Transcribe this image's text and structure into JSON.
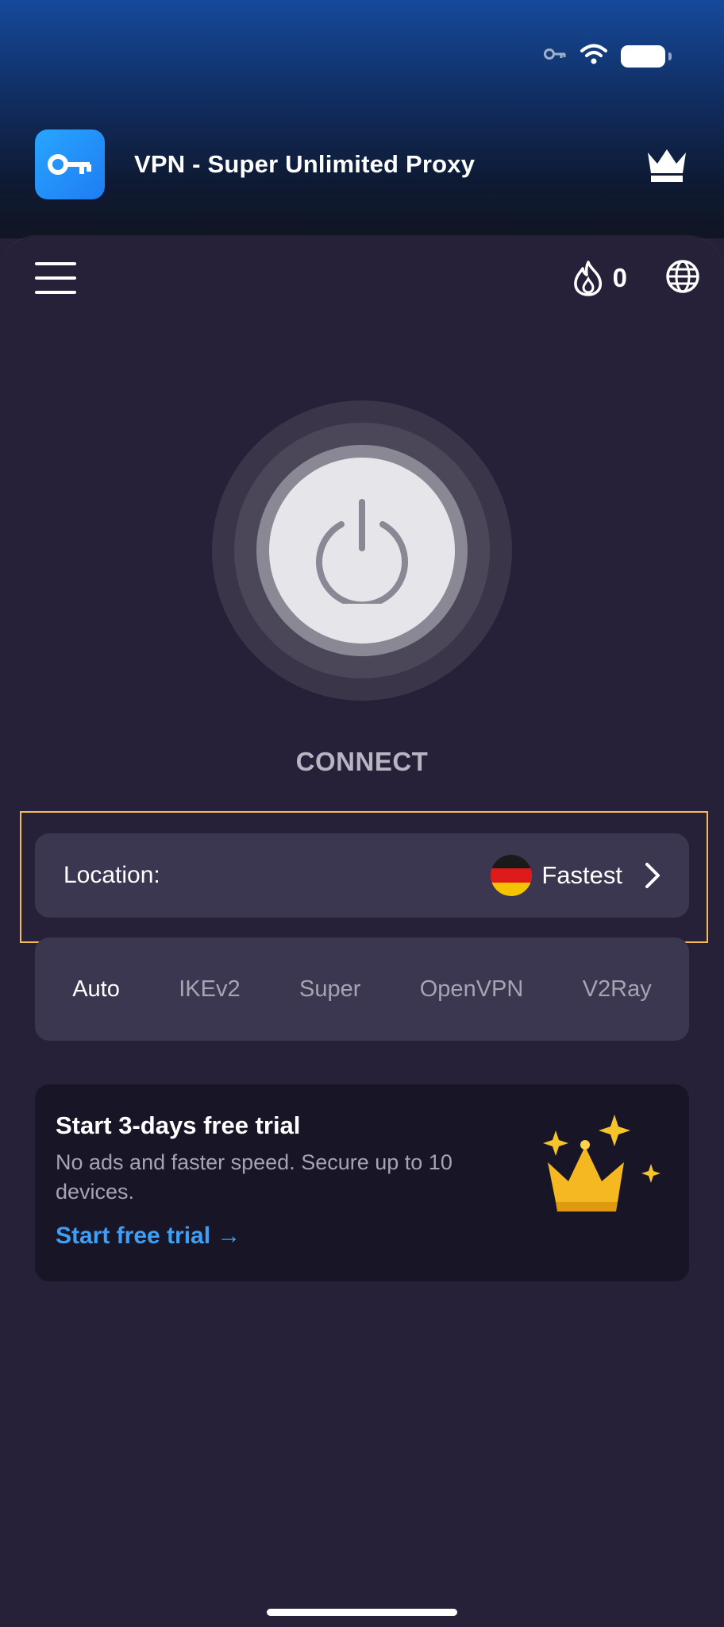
{
  "app": {
    "title": "VPN - Super Unlimited Proxy"
  },
  "toolbar": {
    "streak_count": "0"
  },
  "power": {
    "label": "CONNECT"
  },
  "location": {
    "label": "Location:",
    "value": "Fastest",
    "flag_colors": [
      "#1a1a1a",
      "#dd1b1b",
      "#f5c400"
    ]
  },
  "protocols": {
    "items": [
      "Auto",
      "IKEv2",
      "Super",
      "OpenVPN",
      "V2Ray"
    ],
    "selected": "Auto"
  },
  "trial": {
    "title": "Start 3-days free trial",
    "description": "No ads and faster speed. Secure up to 10 devices.",
    "link": "Start free trial →"
  },
  "colors": {
    "accent_blue": "#3d9ff5",
    "highlight": "#f4bc52",
    "crown_gold": "#f5b820"
  }
}
